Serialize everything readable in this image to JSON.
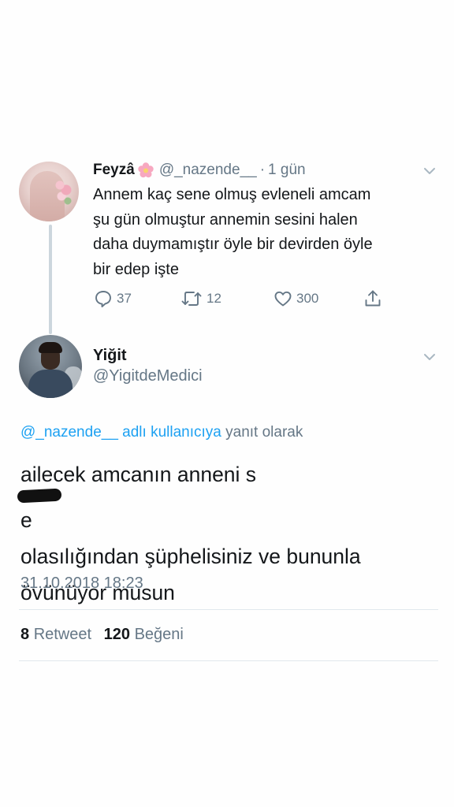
{
  "parent_tweet": {
    "display_name": "Feyzâ",
    "handle": "@_nazende__",
    "separator": "·",
    "time": "1 gün",
    "text_lines": [
      "Annem kaç sene olmuş evleneli amcam",
      "şu gün olmuştur annemin sesini halen",
      "daha duymamıştır öyle bir devirden öyle",
      "bir edep işte"
    ],
    "actions": {
      "reply_count": "37",
      "retweet_count": "12",
      "like_count": "300"
    },
    "icons": [
      "cherry-blossom-icon",
      "reply-icon",
      "retweet-icon",
      "heart-icon",
      "share-icon",
      "chevron-down-icon"
    ]
  },
  "reply_tweet": {
    "display_name": "Yiğit",
    "handle": "@YigitdeMedici",
    "replying_to_mention": "@_nazende__ adlı kullanıcıya",
    "replying_to_suffix": "yanıt olarak",
    "text_lines": {
      "line1_before": "ailecek amcanın anneni s",
      "line1_after": "e",
      "line2": "olasılığından şüphelisiniz ve bununla",
      "line3": "övünüyor musun"
    },
    "timestamp": "31.10.2018 18:23",
    "stats": {
      "retweets_value": "8",
      "retweets_label": "Retweet",
      "likes_value": "120",
      "likes_label": "Beğeni"
    }
  },
  "colors": {
    "text": "#14171a",
    "secondary": "#657786",
    "link": "#1da1f2",
    "divider": "#e1e8ed",
    "thread_line": "#ccd6dd"
  }
}
